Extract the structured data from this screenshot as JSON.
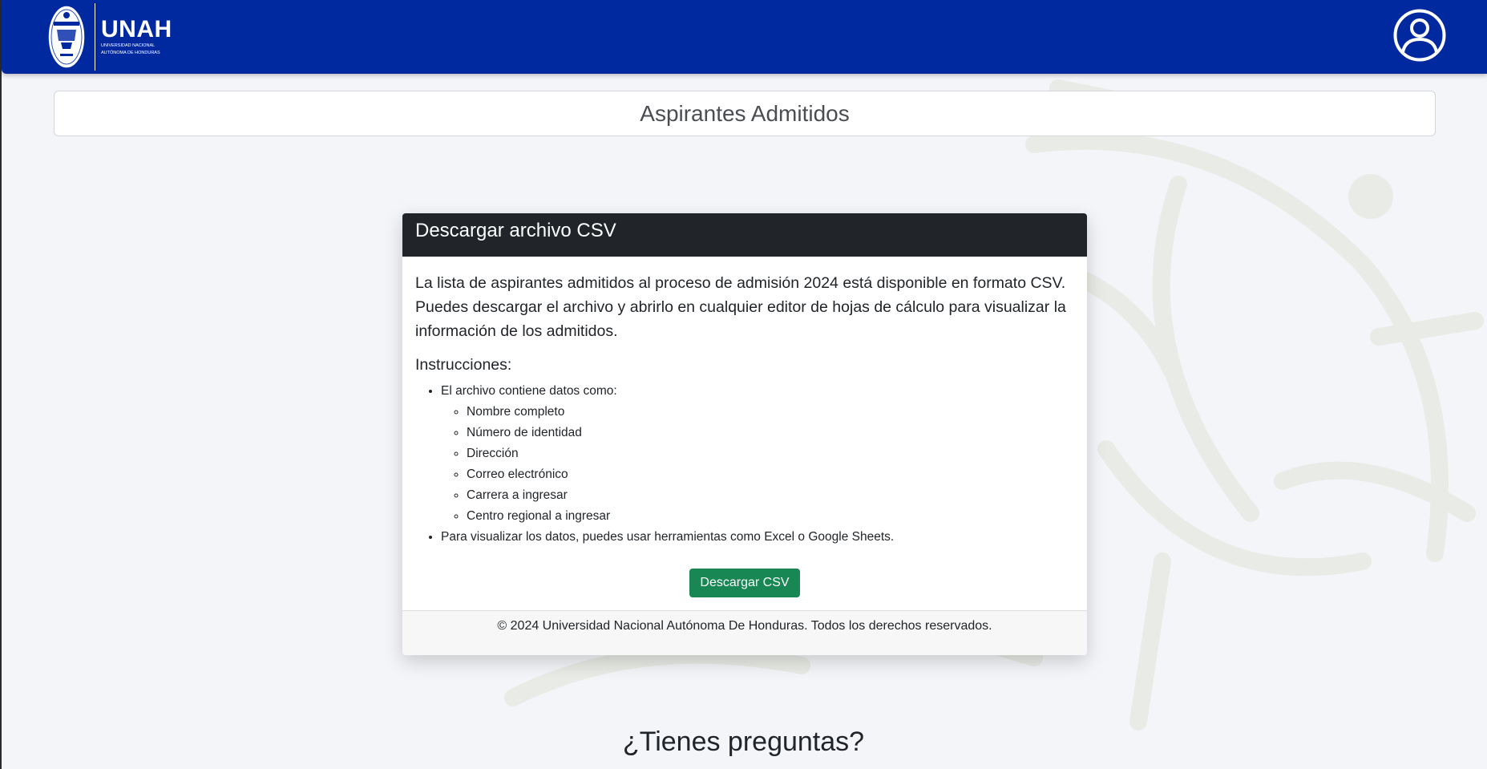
{
  "header": {
    "logo_name": "UNAH",
    "logo_subtitle_line1": "Universidad Nacional",
    "logo_subtitle_line2": "Autónoma de Honduras",
    "profile_icon": "user-circle-icon",
    "background_color": "#0029a0"
  },
  "page": {
    "title": "Aspirantes Admitidos"
  },
  "csv_card": {
    "header": "Descargar archivo CSV",
    "description": "La lista de aspirantes admitidos al proceso de admisión 2024 está disponible en formato CSV. Puedes descargar el archivo y abrirlo en cualquier editor de hojas de cálculo para visualizar la información de los admitidos.",
    "instructions_title": "Instrucciones:",
    "instructions": {
      "item1": "El archivo contiene datos como:",
      "fields": [
        "Nombre completo",
        "Número de identidad",
        "Dirección",
        "Correo electrónico",
        "Carrera a ingresar",
        "Centro regional a ingresar"
      ],
      "item2": "Para visualizar los datos, puedes usar herramientas como Excel o Google Sheets."
    },
    "download_button": "Descargar CSV",
    "footer": "© 2024 Universidad Nacional Autónoma De Honduras. Todos los derechos reservados.",
    "download_button_color": "#198754"
  },
  "questions": {
    "title": "¿Tienes preguntas?"
  }
}
